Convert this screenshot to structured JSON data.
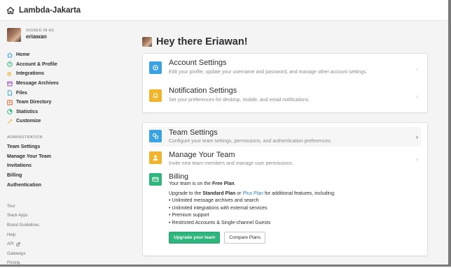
{
  "app": {
    "team_name": "Lambda-Jakarta"
  },
  "user": {
    "signed_in_label": "SIGNED IN AS",
    "username": "eriawan"
  },
  "sidebar": {
    "items": [
      {
        "label": "Home",
        "icon": "home-icon",
        "color": "#3aa3e3"
      },
      {
        "label": "Account & Profile",
        "icon": "user-icon",
        "color": "#2fb67c"
      },
      {
        "label": "Integrations",
        "icon": "plug-icon",
        "color": "#f2b42b"
      },
      {
        "label": "Message Archives",
        "icon": "archive-icon",
        "color": "#9c52b8"
      },
      {
        "label": "Files",
        "icon": "file-icon",
        "color": "#3aa3e3"
      },
      {
        "label": "Team Directory",
        "icon": "team-icon",
        "color": "#e0612f"
      },
      {
        "label": "Statistics",
        "icon": "chart-icon",
        "color": "#2fb67c"
      },
      {
        "label": "Customize",
        "icon": "wand-icon",
        "color": "#f2b42b"
      }
    ],
    "admin_title": "ADMINISTRATION",
    "admin_items": [
      "Team Settings",
      "Manage Your Team",
      "Invitations",
      "Billing",
      "Authentication"
    ],
    "footer_items": [
      "Tour",
      "Slack Apps",
      "Brand Guidelines",
      "Help",
      "API",
      "Gateways",
      "Pricing"
    ]
  },
  "main": {
    "greeting": "Hey there Eriawan!",
    "account_settings": {
      "title": "Account Settings",
      "desc": "Edit your profile, update your username and password, and manage other account settings."
    },
    "notification_settings": {
      "title": "Notification Settings",
      "desc": "Set your preferences for desktop, mobile, and email notifications."
    },
    "team_settings": {
      "title": "Team Settings",
      "desc": "Configure your team settings, permissions, and authentication preferences."
    },
    "manage_team": {
      "title": "Manage Your Team",
      "desc": "Invite new team members and manage user permissions."
    },
    "billing": {
      "title": "Billing",
      "plan_prefix": "Your team is on the ",
      "plan_name": "Free Plan",
      "plan_suffix": ".",
      "upgrade_prefix": "Upgrade to the ",
      "standard_plan": "Standard Plan",
      "or": " or ",
      "plus_plan": "Plus Plan",
      "upgrade_suffix": " for additional features, including:",
      "features": [
        "• Unlimited message archives and search",
        "• Unlimited integrations with external services",
        "• Premium support",
        "• Restricted Accounts & Single-channel Guests"
      ],
      "upgrade_button": "Upgrade your team",
      "compare_button": "Compare Plans"
    },
    "chevron": "›"
  },
  "colors": {
    "accent_blue": "#3aa3e3",
    "accent_gold": "#f2b42b",
    "accent_green": "#2fb67c",
    "link": "#2a80b9"
  }
}
